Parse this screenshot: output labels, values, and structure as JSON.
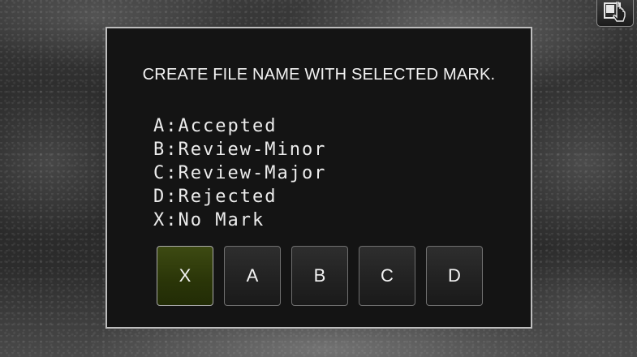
{
  "dialog": {
    "title": "CREATE FILE NAME WITH SELECTED MARK.",
    "legend": [
      "A:Accepted",
      "B:Review-Minor",
      "C:Review-Major",
      "D:Rejected",
      "X:No Mark"
    ],
    "marks": [
      {
        "label": "X",
        "selected": true
      },
      {
        "label": "A",
        "selected": false
      },
      {
        "label": "B",
        "selected": false
      },
      {
        "label": "C",
        "selected": false
      },
      {
        "label": "D",
        "selected": false
      }
    ]
  },
  "corner_button": {
    "icon": "window-touch-icon"
  },
  "colors": {
    "selected_mark": "#2a3508",
    "dialog_background": "#141414",
    "dialog_border": "#bdbdbd"
  }
}
